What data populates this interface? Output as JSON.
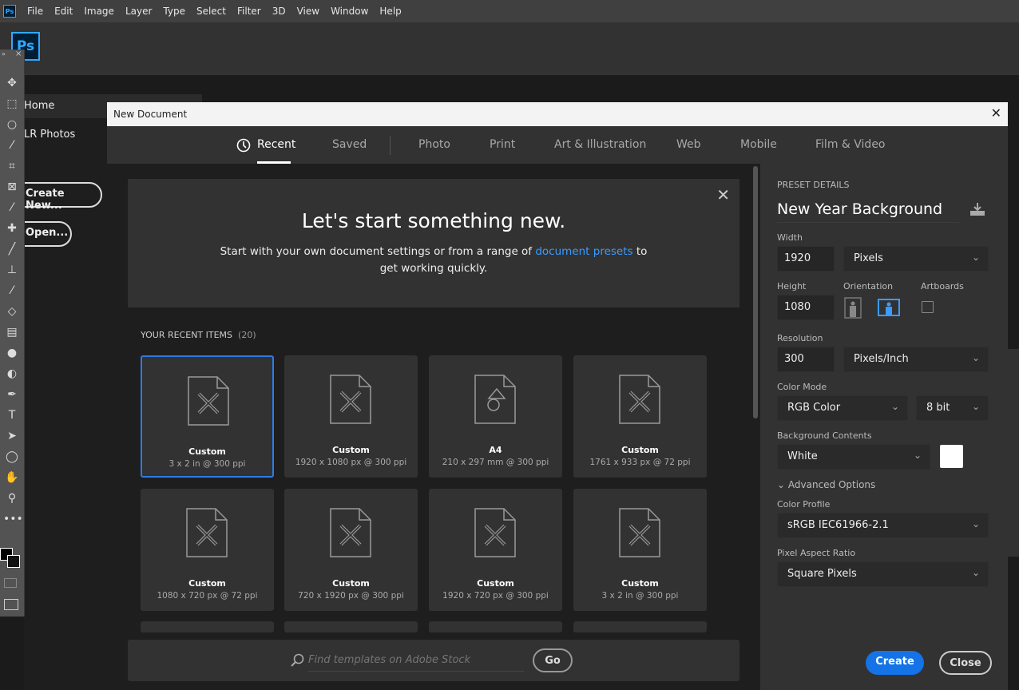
{
  "menubar": {
    "logo": "Ps",
    "items": [
      "File",
      "Edit",
      "Image",
      "Layer",
      "Type",
      "Select",
      "Filter",
      "3D",
      "View",
      "Window",
      "Help"
    ]
  },
  "app_logo": "Ps",
  "home": {
    "items": [
      "Home",
      "LR Photos"
    ],
    "create_new": "Create New...",
    "open": "Open..."
  },
  "toolbar": {
    "tools": [
      "move-icon",
      "marquee-icon",
      "lasso-icon",
      "magic-wand-icon",
      "crop-icon",
      "frame-icon",
      "eyedropper-icon",
      "healing-icon",
      "brush-icon",
      "stamp-icon",
      "history-brush-icon",
      "eraser-icon",
      "gradient-icon",
      "blur-icon",
      "dodge-icon",
      "pen-icon",
      "type-icon",
      "path-select-icon",
      "ellipse-icon",
      "hand-icon",
      "zoom-icon",
      "more-icon"
    ]
  },
  "dialog": {
    "title": "New Document",
    "tabs": [
      "Recent",
      "Saved",
      "Photo",
      "Print",
      "Art & Illustration",
      "Web",
      "Mobile",
      "Film & Video"
    ],
    "active_tab": "Recent",
    "hero": {
      "title": "Let's start something new.",
      "text_before": "Start with your own document settings or from a range of ",
      "link": "document presets",
      "text_after": " to get working quickly."
    },
    "recent_label": "YOUR RECENT ITEMS",
    "recent_count": "(20)",
    "items": [
      {
        "name": "Custom",
        "size": "3 x 2 in @ 300 ppi",
        "icon": "custom",
        "selected": true
      },
      {
        "name": "Custom",
        "size": "1920 x 1080 px @ 300 ppi",
        "icon": "custom"
      },
      {
        "name": "A4",
        "size": "210 x 297 mm @ 300 ppi",
        "icon": "print"
      },
      {
        "name": "Custom",
        "size": "1761 x 933 px @ 72 ppi",
        "icon": "custom"
      },
      {
        "name": "Custom",
        "size": "1080 x 720 px @ 72 ppi",
        "icon": "custom"
      },
      {
        "name": "Custom",
        "size": "720 x 1920 px @ 300 ppi",
        "icon": "custom"
      },
      {
        "name": "Custom",
        "size": "1920 x 720 px @ 300 ppi",
        "icon": "custom"
      },
      {
        "name": "Custom",
        "size": "3 x 2 in @ 300 ppi",
        "icon": "custom"
      }
    ],
    "search": {
      "placeholder": "Find templates on Adobe Stock",
      "go": "Go"
    },
    "preset": {
      "header": "PRESET DETAILS",
      "name": "New Year Background",
      "width_label": "Width",
      "width": "1920",
      "width_unit": "Pixels",
      "height_label": "Height",
      "height": "1080",
      "orientation_label": "Orientation",
      "orientation": "landscape",
      "artboards_label": "Artboards",
      "artboards": false,
      "resolution_label": "Resolution",
      "resolution": "300",
      "resolution_unit": "Pixels/Inch",
      "color_mode_label": "Color Mode",
      "color_mode": "RGB Color",
      "bit_depth": "8 bit",
      "bg_label": "Background Contents",
      "bg": "White",
      "bg_color": "#ffffff",
      "advanced": "Advanced Options",
      "profile_label": "Color Profile",
      "profile": "sRGB IEC61966-2.1",
      "par_label": "Pixel Aspect Ratio",
      "par": "Square Pixels"
    },
    "create": "Create",
    "close": "Close"
  },
  "colors": {
    "accent": "#1473e6",
    "selection": "#2d7be5",
    "link": "#3b9bff",
    "ps_blue": "#31a8ff"
  }
}
